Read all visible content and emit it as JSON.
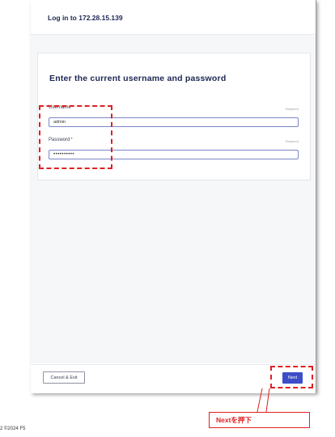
{
  "window": {
    "title": "Log in to 172.28.15.139"
  },
  "form": {
    "heading": "Enter the current username and password",
    "username": {
      "label": "Username",
      "required_mark": "*",
      "hint": "Required",
      "value": "admin"
    },
    "password": {
      "label": "Password",
      "required_mark": "*",
      "hint": "Required",
      "value": "••••••••••"
    }
  },
  "footer": {
    "cancel_label": "Cancel & Exit",
    "next_label": "Next"
  },
  "annotation": {
    "callout_text": "Nextを押下",
    "color": "#e02020"
  },
  "page_footer": {
    "copyright": "2  ©2024 F5"
  },
  "colors": {
    "primary": "#3b4dc8",
    "title": "#1d2653"
  }
}
